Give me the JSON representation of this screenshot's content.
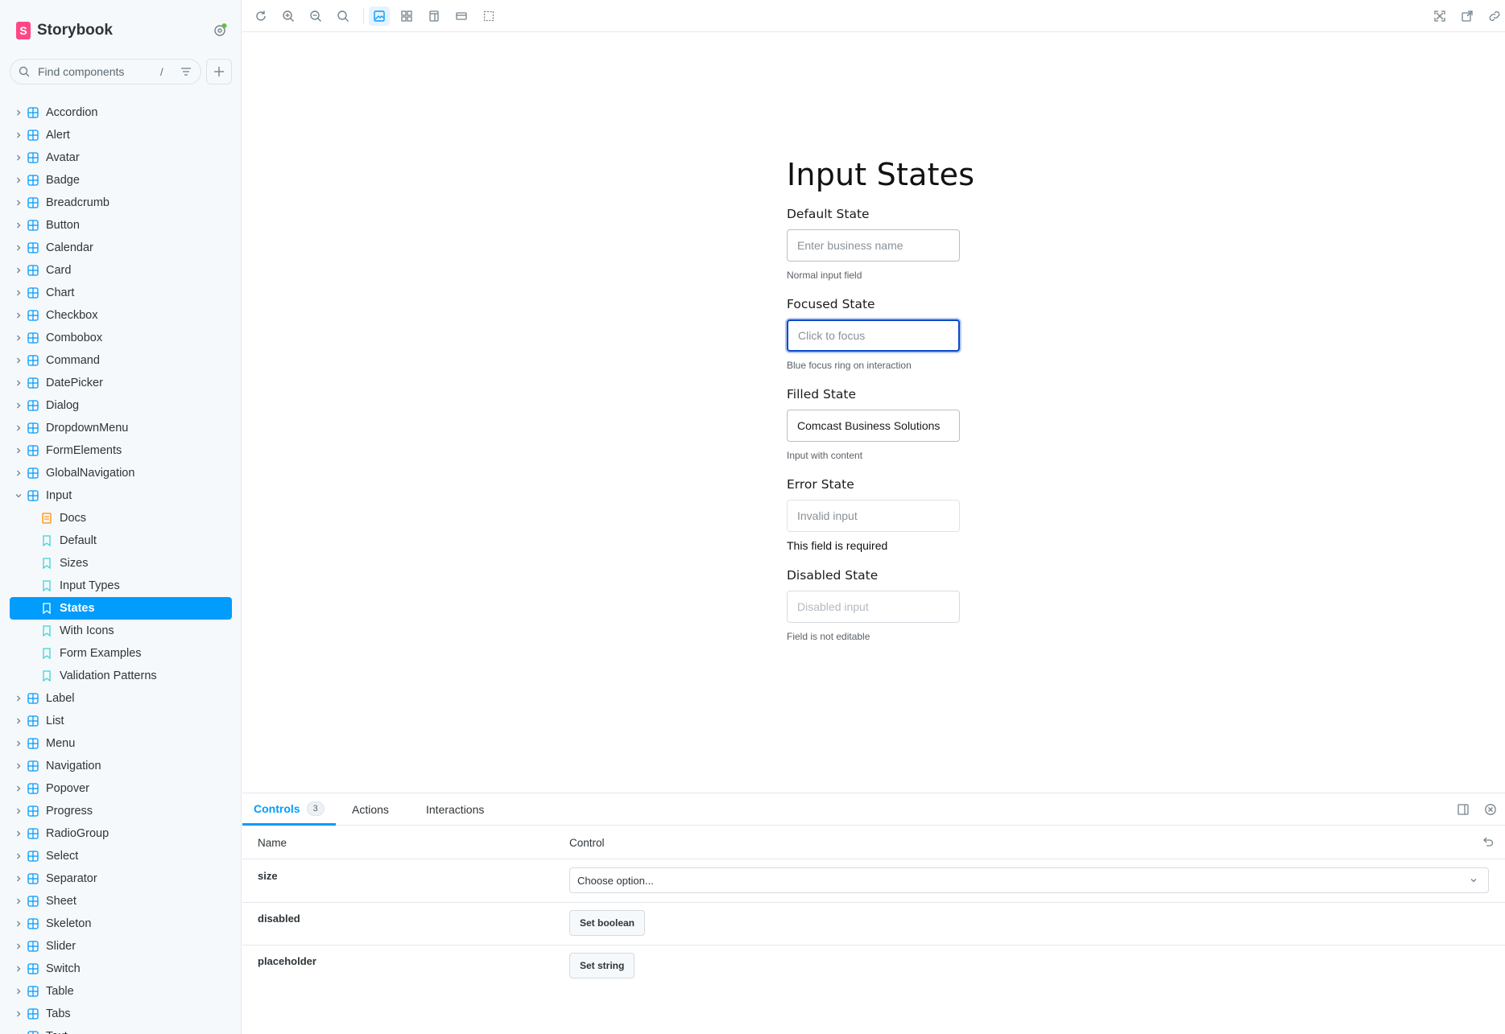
{
  "brand": {
    "name": "Storybook",
    "logo_letter": "S"
  },
  "search": {
    "placeholder": "Find components",
    "shortcut": "/"
  },
  "sidebar": {
    "items_before": [
      "Accordion",
      "Alert",
      "Avatar",
      "Badge",
      "Breadcrumb",
      "Button",
      "Calendar",
      "Card",
      "Chart",
      "Checkbox",
      "Combobox",
      "Command",
      "DatePicker",
      "Dialog",
      "DropdownMenu",
      "FormElements",
      "GlobalNavigation"
    ],
    "expanded": {
      "label": "Input",
      "children": [
        {
          "label": "Docs",
          "type": "docs"
        },
        {
          "label": "Default",
          "type": "story"
        },
        {
          "label": "Sizes",
          "type": "story"
        },
        {
          "label": "Input Types",
          "type": "story"
        },
        {
          "label": "States",
          "type": "story",
          "selected": true
        },
        {
          "label": "With Icons",
          "type": "story"
        },
        {
          "label": "Form Examples",
          "type": "story"
        },
        {
          "label": "Validation Patterns",
          "type": "story"
        }
      ]
    },
    "items_after": [
      "Label",
      "List",
      "Menu",
      "Navigation",
      "Popover",
      "Progress",
      "RadioGroup",
      "Select",
      "Separator",
      "Sheet",
      "Skeleton",
      "Slider",
      "Switch",
      "Table",
      "Tabs",
      "Text"
    ]
  },
  "story": {
    "title": "Input States",
    "default": {
      "label": "Default State",
      "placeholder": "Enter business name",
      "hint": "Normal input field"
    },
    "focused": {
      "label": "Focused State",
      "placeholder": "Click to focus",
      "hint": "Blue focus ring on interaction"
    },
    "filled": {
      "label": "Filled State",
      "value": "Comcast Business Solutions",
      "hint": "Input with content"
    },
    "error": {
      "label": "Error State",
      "placeholder": "Invalid input",
      "message": "This field is required"
    },
    "disabled": {
      "label": "Disabled State",
      "placeholder": "Disabled input",
      "hint": "Field is not editable"
    }
  },
  "addons": {
    "tabs": {
      "controls": "Controls",
      "controls_count": "3",
      "actions": "Actions",
      "interactions": "Interactions"
    },
    "columns": {
      "name": "Name",
      "control": "Control"
    },
    "rows": {
      "size": {
        "name": "size",
        "value": "Choose option..."
      },
      "disabled": {
        "name": "disabled",
        "button": "Set boolean"
      },
      "placeholder": {
        "name": "placeholder",
        "button": "Set string"
      }
    }
  },
  "colors": {
    "accent": "#029cfd",
    "brand": "#ff4785",
    "focus": "#0a48c9"
  }
}
